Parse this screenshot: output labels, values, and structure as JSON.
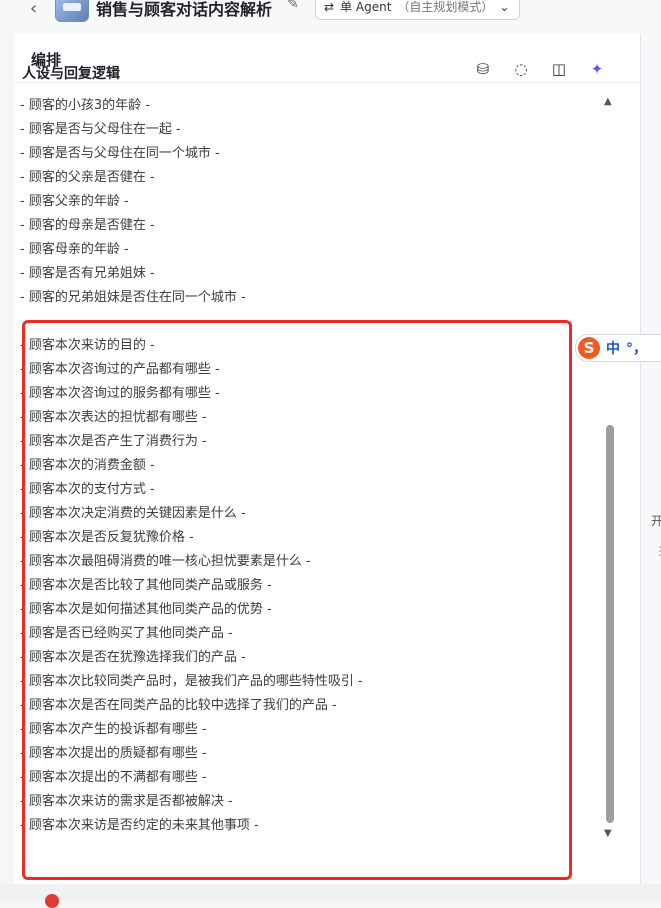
{
  "header": {
    "title": "销售与顾客对话内容解析",
    "mode": {
      "label": "单 Agent",
      "sublabel": "（自主规划模式）"
    }
  },
  "panel": {
    "heading": "编排",
    "section_title": "人设与回复逻辑",
    "lines": [
      "- 顾客的小孩3的年龄 -",
      "- 顾客是否与父母住在一起 -",
      "- 顾客是否与父母住在同一个城市 -",
      "- 顾客的父亲是否健在 -",
      "- 顾客父亲的年龄 -",
      "- 顾客的母亲是否健在 -",
      "- 顾客母亲的年龄 -",
      "- 顾客是否有兄弟姐妹 -",
      "- 顾客的兄弟姐妹是否住在同一个城市 -",
      "",
      "- 顾客本次来访的目的 -",
      "- 顾客本次咨询过的产品都有哪些 -",
      "- 顾客本次咨询过的服务都有哪些 -",
      "- 顾客本次表达的担忧都有哪些 -",
      "- 顾客本次是否产生了消费行为 -",
      "- 顾客本次的消费金额 -",
      "- 顾客本次的支付方式 -",
      "- 顾客本次决定消费的关键因素是什么 -",
      "- 顾客本次是否反复犹豫价格 -",
      "- 顾客本次最阻碍消费的唯一核心担忧要素是什么 -",
      "- 顾客本次是否比较了其他同类产品或服务 -",
      "- 顾客本次是如何描述其他同类产品的优势 -",
      "- 顾客是否已经购买了其他同类产品 -",
      "- 顾客本次是否在犹豫选择我们的产品 -",
      "- 顾客本次比较同类产品时，是被我们产品的哪些特性吸引 -",
      "- 顾客本次是否在同类产品的比较中选择了我们的产品 -",
      "- 顾客本次产生的投诉都有哪些 -",
      "- 顾客本次提出的质疑都有哪些 -",
      "- 顾客本次提出的不满都有哪些 -",
      "- 顾客本次来访的需求是否都被解决 -",
      "- 顾客本次来访是否约定的未来其他事项 -"
    ]
  },
  "ime": {
    "logo": "S",
    "lang": "中",
    "punct": "°，"
  },
  "side": {
    "text": "开",
    "dots": "⋮"
  },
  "colors": {
    "highlight": "#ee2a24",
    "accent": "#5b5bf0",
    "ime": "#f05a24"
  }
}
